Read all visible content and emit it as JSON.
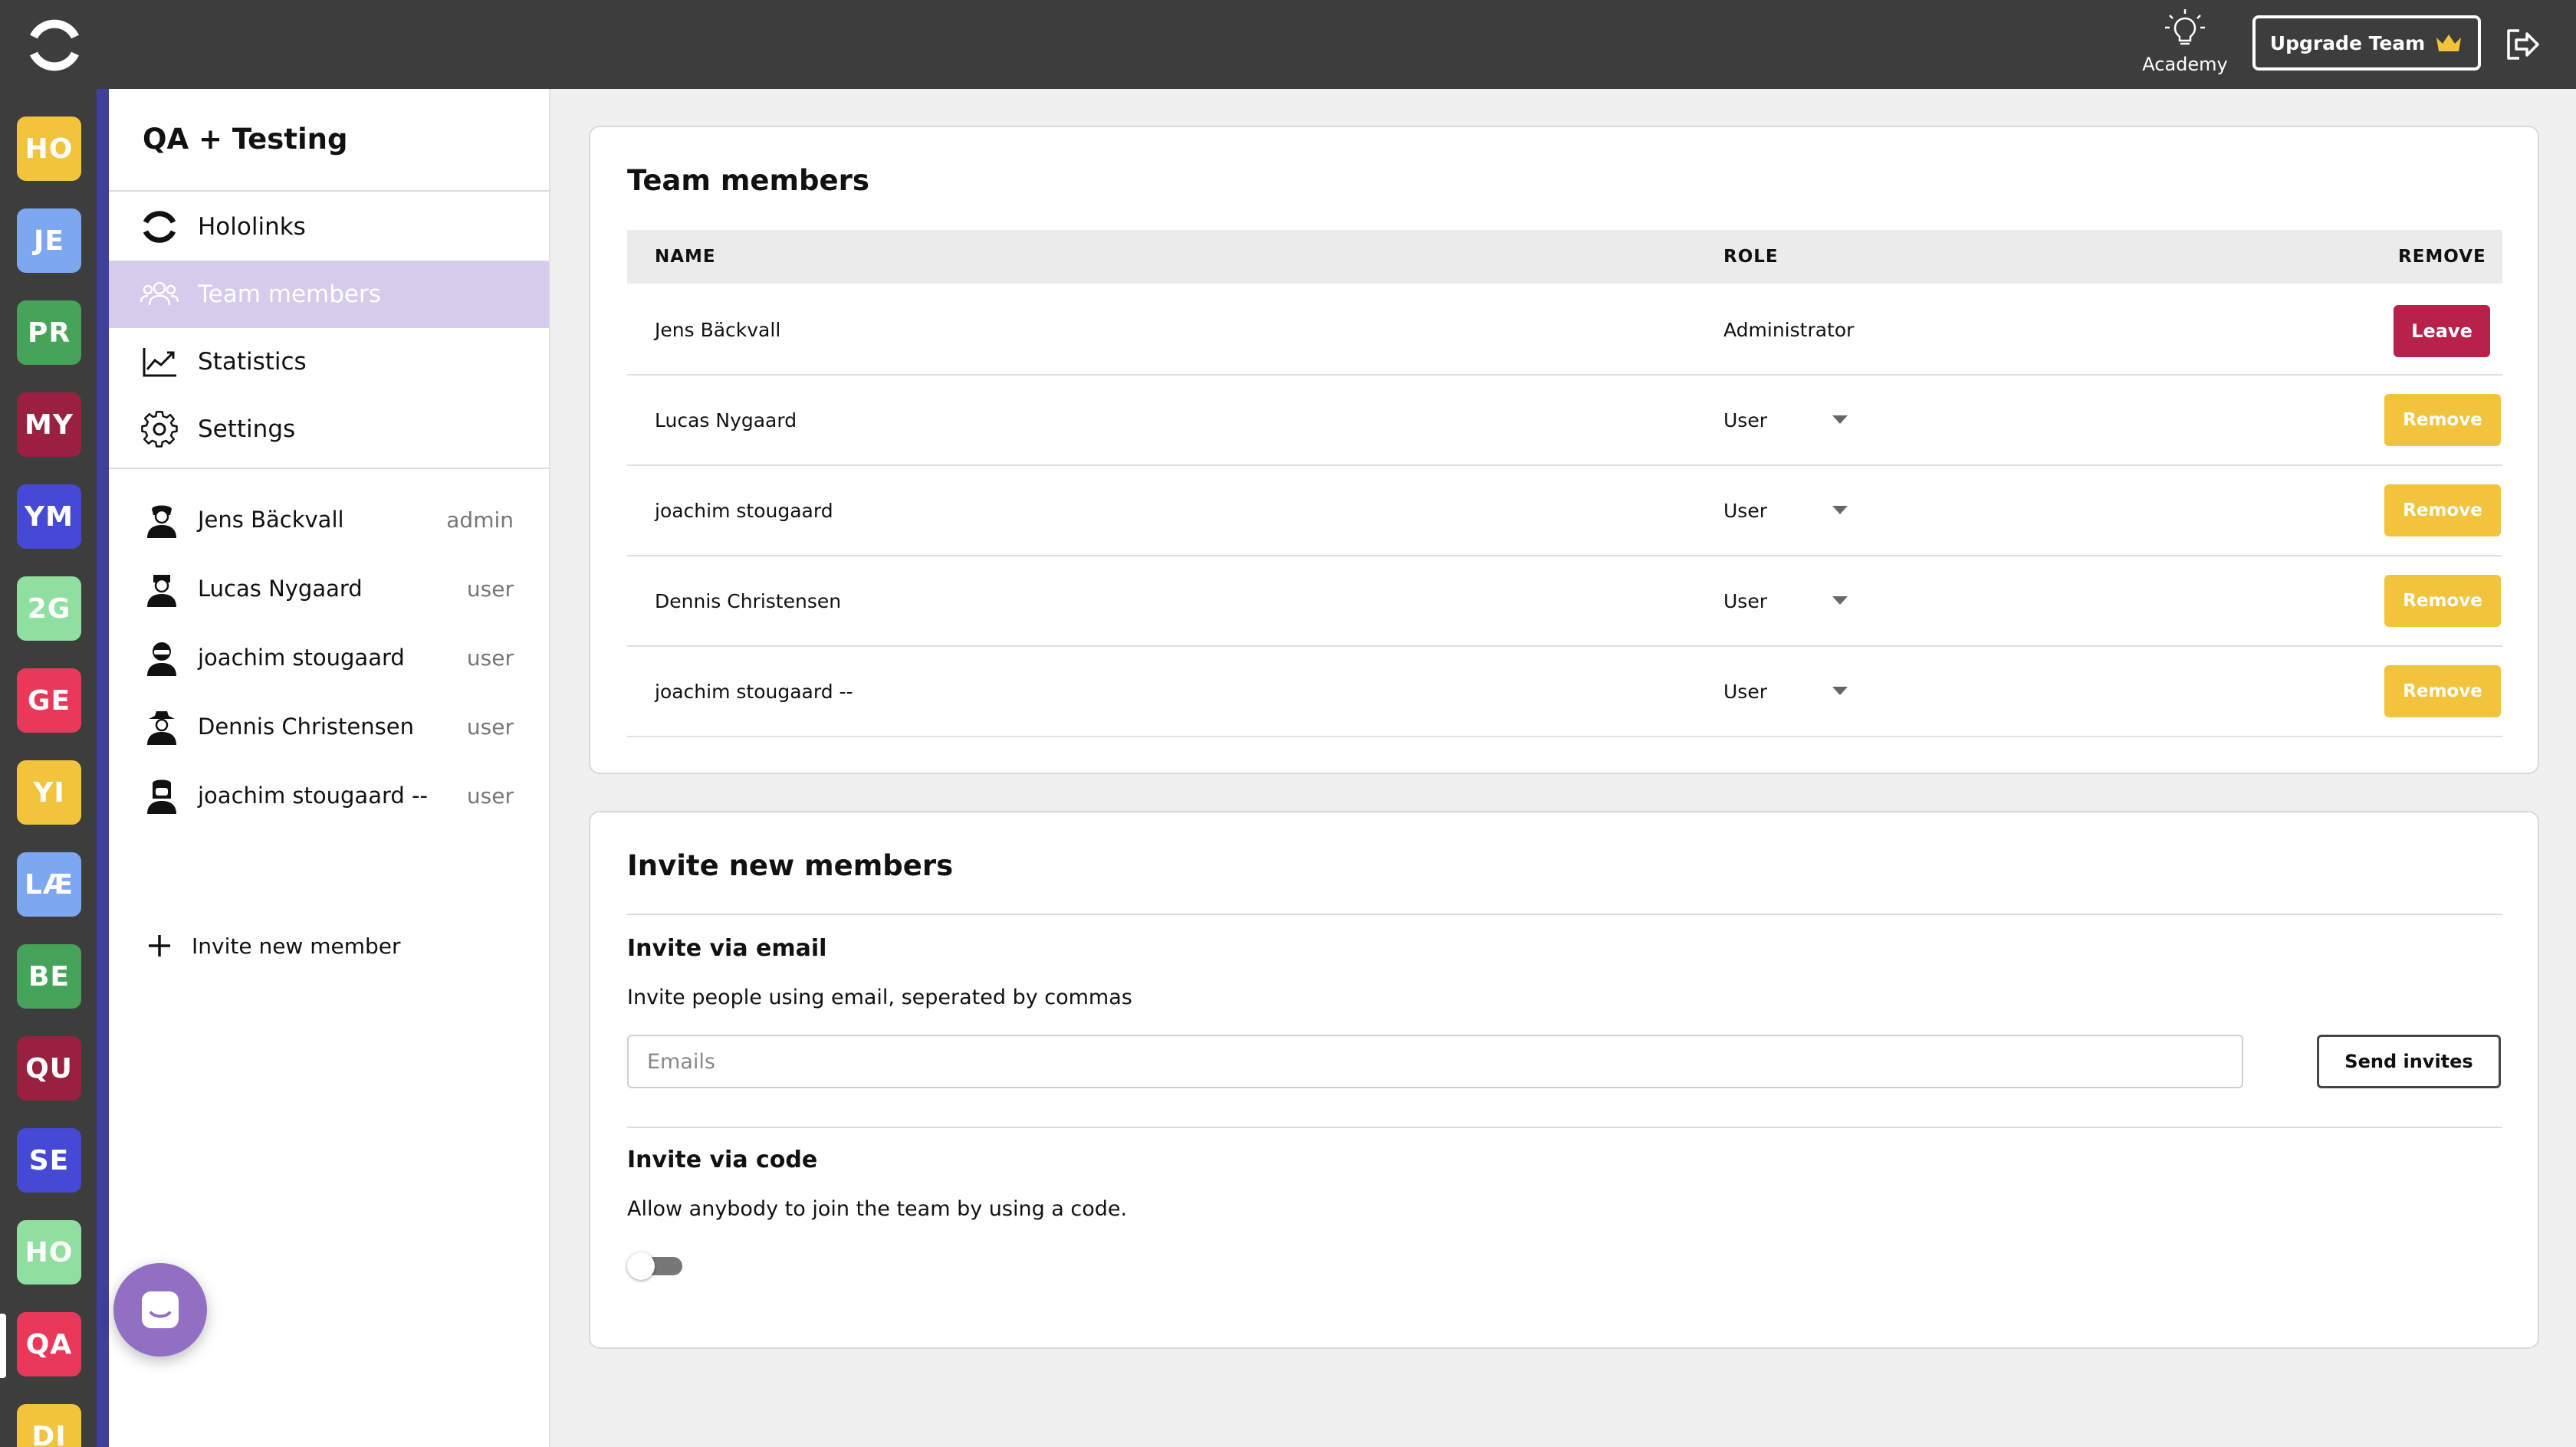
{
  "topbar": {
    "academy_label": "Academy",
    "upgrade_label": "Upgrade Team",
    "icons": [
      "app-logo-icon",
      "lightbulb-icon",
      "crown-icon",
      "logout-icon"
    ]
  },
  "rail": {
    "teams": [
      {
        "label": "HO",
        "color": "#f2c33d"
      },
      {
        "label": "JE",
        "color": "#7ea7f2"
      },
      {
        "label": "PR",
        "color": "#45a35a"
      },
      {
        "label": "MY",
        "color": "#9a2040"
      },
      {
        "label": "YM",
        "color": "#4648d6"
      },
      {
        "label": "2G",
        "color": "#8fdfa0"
      },
      {
        "label": "GE",
        "color": "#e8395a"
      },
      {
        "label": "YI",
        "color": "#f2c33d"
      },
      {
        "label": "LÆ",
        "color": "#7ea7f2"
      },
      {
        "label": "BE",
        "color": "#45a35a"
      },
      {
        "label": "QU",
        "color": "#9a2040"
      },
      {
        "label": "SE",
        "color": "#4648d6"
      },
      {
        "label": "HO",
        "color": "#8fdfa0"
      },
      {
        "label": "QA",
        "color": "#e8395a"
      },
      {
        "label": "DI",
        "color": "#f2c33d"
      }
    ]
  },
  "sidebar": {
    "team_name": "QA + Testing",
    "nav": [
      {
        "label": "Hololinks",
        "icon": "hololinks-icon"
      },
      {
        "label": "Team members",
        "icon": "team-icon"
      },
      {
        "label": "Statistics",
        "icon": "chart-icon"
      },
      {
        "label": "Settings",
        "icon": "gear-icon"
      }
    ],
    "members": [
      {
        "name": "Jens Bäckvall",
        "role": "admin"
      },
      {
        "name": "Lucas Nygaard",
        "role": "user"
      },
      {
        "name": "joachim stougaard",
        "role": "user"
      },
      {
        "name": "Dennis Christensen",
        "role": "user"
      },
      {
        "name": "joachim stougaard --",
        "role": "user"
      }
    ],
    "invite_label": "Invite new member"
  },
  "team_members": {
    "title": "Team members",
    "headers": {
      "name": "NAME",
      "role": "ROLE",
      "remove": "REMOVE"
    },
    "rows": [
      {
        "name": "Jens Bäckvall",
        "role": "Administrator",
        "action": "Leave"
      },
      {
        "name": "Lucas Nygaard",
        "role": "User",
        "action": "Remove"
      },
      {
        "name": "joachim stougaard",
        "role": "User",
        "action": "Remove"
      },
      {
        "name": "Dennis Christensen",
        "role": "User",
        "action": "Remove"
      },
      {
        "name": "joachim stougaard --",
        "role": "User",
        "action": "Remove"
      }
    ]
  },
  "invite": {
    "title": "Invite new members",
    "email_title": "Invite via email",
    "email_desc": "Invite people using email, seperated by commas",
    "email_placeholder": "Emails",
    "send_label": "Send invites",
    "code_title": "Invite via code",
    "code_desc": "Allow anybody to join the team by using a code.",
    "code_enabled": false
  },
  "colors": {
    "topbar": "#3d3d3d",
    "active_nav": "#d6cbeb",
    "leave": "#b8214a",
    "remove": "#f2c33d",
    "chat": "#9170c4"
  }
}
